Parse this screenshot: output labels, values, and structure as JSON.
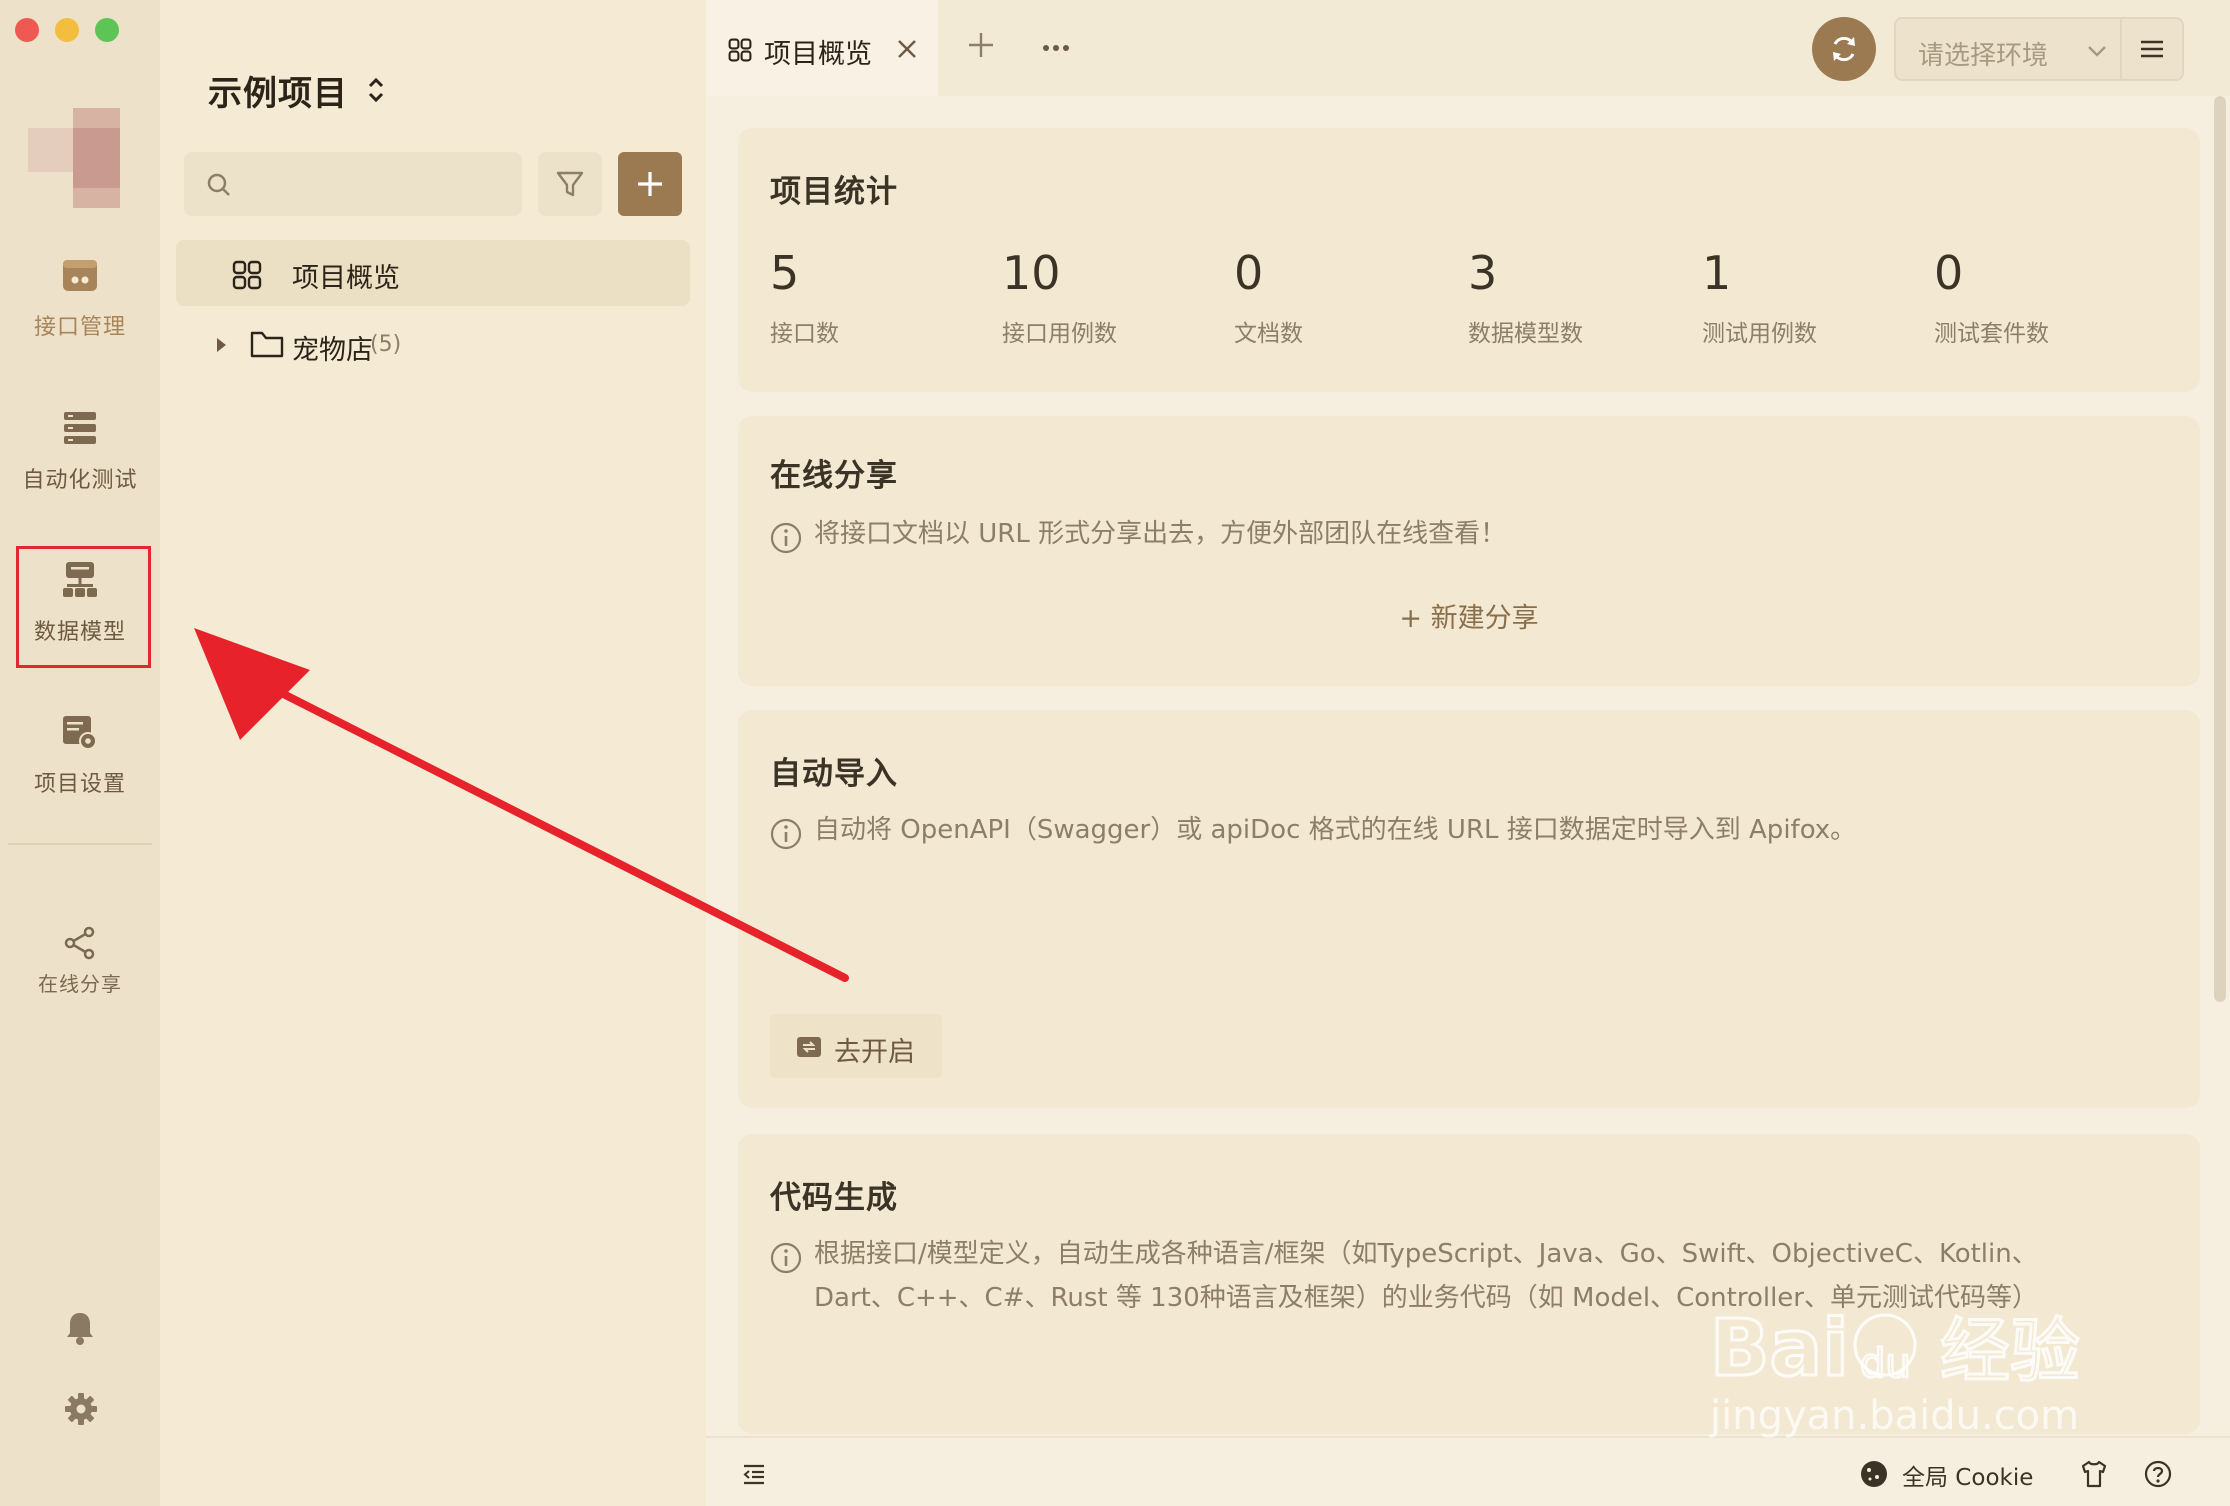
{
  "window": {
    "controls": [
      "close",
      "minimize",
      "zoom"
    ]
  },
  "rail": {
    "items": [
      {
        "label": "接口管理",
        "icon": "api-management-icon"
      },
      {
        "label": "自动化测试",
        "icon": "automated-test-icon"
      },
      {
        "label": "数据模型",
        "icon": "data-model-icon"
      },
      {
        "label": "项目设置",
        "icon": "project-settings-icon"
      }
    ],
    "share": {
      "label": "在线分享",
      "icon": "share-icon"
    },
    "bottom_icons": [
      "bell-icon",
      "gear-icon"
    ]
  },
  "tree": {
    "project_title": "示例项目",
    "search": {
      "placeholder": ""
    },
    "items": [
      {
        "label": "项目概览",
        "selected": true
      },
      {
        "label": "宠物店",
        "count": "(5)"
      }
    ]
  },
  "tabs": [
    {
      "label": "项目概览",
      "active": true
    }
  ],
  "toolbar": {
    "env_placeholder": "请选择环境"
  },
  "stats": {
    "title": "项目统计",
    "items": [
      {
        "value": "5",
        "label": "接口数"
      },
      {
        "value": "10",
        "label": "接口用例数"
      },
      {
        "value": "0",
        "label": "文档数"
      },
      {
        "value": "3",
        "label": "数据模型数"
      },
      {
        "value": "1",
        "label": "测试用例数"
      },
      {
        "value": "0",
        "label": "测试套件数"
      }
    ]
  },
  "share_card": {
    "title": "在线分享",
    "desc": "将接口文档以 URL 形式分享出去，方便外部团队在线查看！",
    "action": "+ 新建分享"
  },
  "import_card": {
    "title": "自动导入",
    "desc": "自动将 OpenAPI（Swagger）或 apiDoc 格式的在线 URL 接口数据定时导入到 Apifox。",
    "action": "去开启"
  },
  "codegen_card": {
    "title": "代码生成",
    "desc_line1": "根据接口/模型定义，自动生成各种语言/框架（如TypeScript、Java、Go、Swift、ObjectiveC、Kotlin、",
    "desc_line2": "Dart、C++、C#、Rust 等 130种语言及框架）的业务代码（如 Model、Controller、单元测试代码等）"
  },
  "statusbar": {
    "cookie_label": "全局 Cookie"
  },
  "watermark": {
    "brand": "Bai du 经验",
    "url": "jingyan.baidu.com"
  },
  "colors": {
    "accent": "#9b7a52",
    "highlight": "#e4262f",
    "rail_bg": "#ede2c9",
    "panel_bg": "#f5ebd5",
    "card_bg": "#f3e9d2"
  }
}
